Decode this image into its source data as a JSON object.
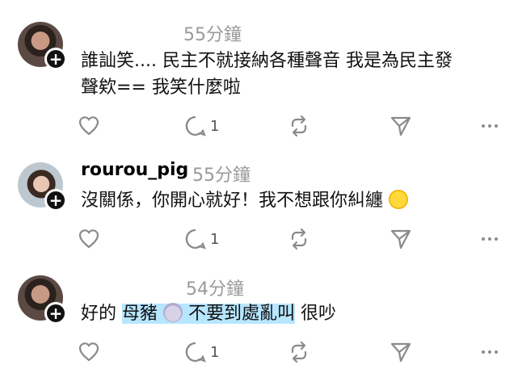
{
  "comments": [
    {
      "timestamp": "55分鐘",
      "text_line1": "誰訕笑.... 民主不就接納各種聲音 我是為民主發",
      "text_line2": "聲欸== 我笑什麼啦",
      "reply_count": "1"
    },
    {
      "username": "rourou_pig",
      "timestamp": "55分鐘",
      "text": "沒關係，你開心就好！我不想跟你糾纏",
      "reply_count": "1"
    },
    {
      "timestamp": "54分鐘",
      "text_pre": "好的 ",
      "text_highlight_a": "母豬",
      "text_highlight_b": "不要到處亂叫",
      "text_post": " 很吵",
      "reply_count": "1"
    }
  ],
  "icons": [
    "heart-icon",
    "comment-icon",
    "repost-icon",
    "share-icon",
    "more-icon",
    "follow-plus-icon",
    "avatar",
    "blush-emoji",
    "pig-emoji"
  ],
  "colors": {
    "timestamp": "#9a9a9a",
    "highlight": "#b7e6ff",
    "icon": "#8a8a8a"
  }
}
